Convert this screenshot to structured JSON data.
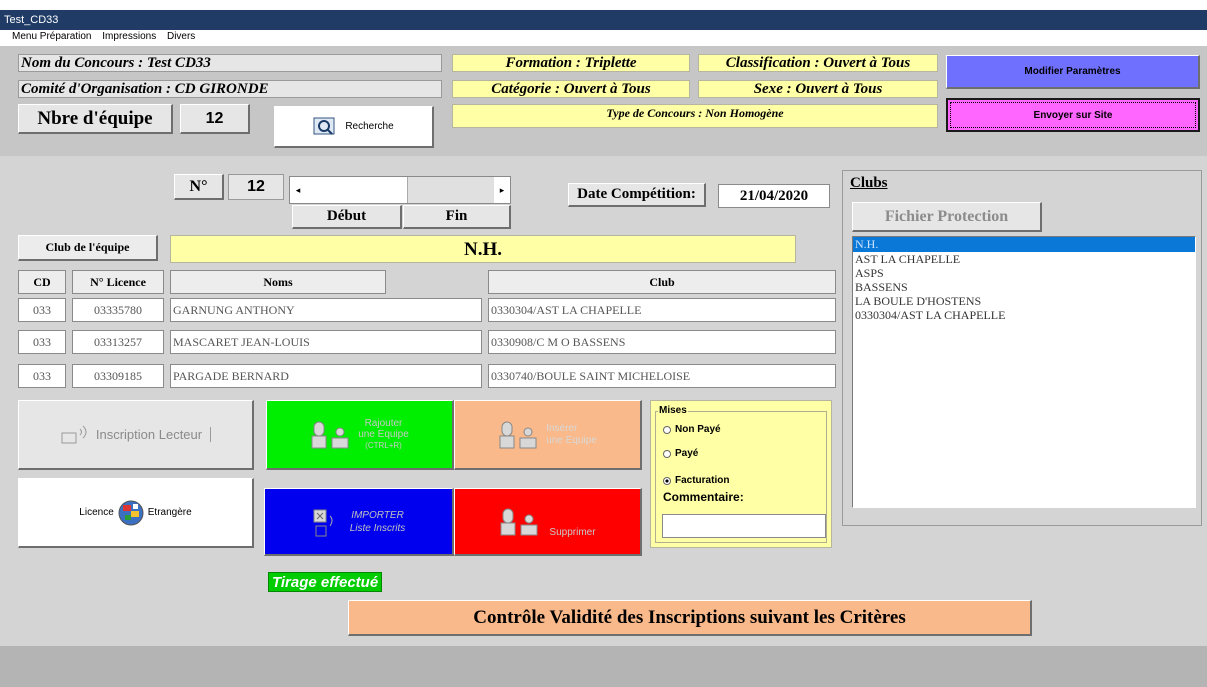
{
  "window": {
    "title": "Test_CD33"
  },
  "menu": [
    "Menu Préparation",
    "Impressions",
    "Divers"
  ],
  "header": {
    "concours": "Nom du Concours : Test  CD33",
    "comite": "Comité d'Organisation : CD GIRONDE",
    "nbre_label": "Nbre d'équipe",
    "nbre_value": "12",
    "recherche": "Recherche",
    "formation": "Formation : Triplette",
    "classification": "Classification : Ouvert à Tous",
    "categorie": "Catégorie : Ouvert à Tous",
    "sexe": "Sexe : Ouvert à Tous",
    "type": "Type de Concours : Non Homogène",
    "modifier": "Modifier Paramètres",
    "envoyer": "Envoyer sur Site"
  },
  "nav": {
    "num_label": "N°",
    "num_value": "12",
    "debut": "Début",
    "fin": "Fin",
    "date_label": "Date Compétition:",
    "date_value": "21/04/2020"
  },
  "club_equipe": {
    "label": "Club de l'équipe",
    "value": "N.H."
  },
  "table": {
    "headers": {
      "cd": "CD",
      "licence": "N° Licence",
      "noms": "Noms",
      "club": "Club"
    },
    "rows": [
      {
        "cd": "033",
        "licence": "03335780",
        "nom": "GARNUNG ANTHONY",
        "club": "0330304/AST LA CHAPELLE"
      },
      {
        "cd": "033",
        "licence": "03313257",
        "nom": "MASCARET JEAN-LOUIS",
        "club": "0330908/C M O BASSENS"
      },
      {
        "cd": "033",
        "licence": "03309185",
        "nom": "PARGADE BERNARD",
        "club": "0330740/BOULE SAINT MICHELOISE"
      }
    ]
  },
  "clubs": {
    "title": "Clubs",
    "fichier": "Fichier Protection",
    "items": [
      "N.H.",
      "AST LA CHAPELLE",
      "ASPS",
      "BASSENS",
      "LA BOULE D'HOSTENS",
      "0330304/AST LA CHAPELLE"
    ]
  },
  "actions": {
    "inscription": "Inscription Lecteur",
    "rajouter_1": "Rajouter",
    "rajouter_2": "une Equipe",
    "rajouter_3": "(CTRL+R)",
    "inserer_1": "Insérer",
    "inserer_2": "une Equipe",
    "licence_a": "Licence",
    "licence_b": "Etrangère",
    "importer_1": "IMPORTER",
    "importer_2": "Liste Inscrits",
    "supprimer": "Supprimer"
  },
  "mises": {
    "title": "Mises",
    "non_paye": "Non Payé",
    "paye": "Payé",
    "facturation": "Facturation",
    "commentaire": "Commentaire:"
  },
  "tirage": "Tirage effectué",
  "controle": "Contrôle Validité des Inscriptions suivant les Critères",
  "colors": {
    "green": "#00ee00",
    "orange": "#f9b98a",
    "blue": "#0000ee",
    "red": "#ff0000",
    "magenta": "#ff66ff",
    "purple": "#7070ff",
    "yellow": "#ffffa6"
  }
}
